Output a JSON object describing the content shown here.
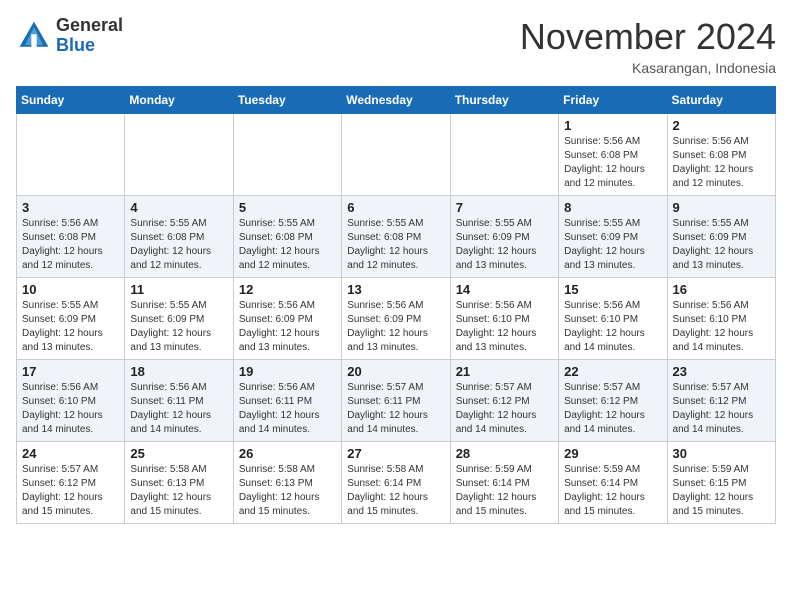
{
  "header": {
    "logo_line1": "General",
    "logo_line2": "Blue",
    "month": "November 2024",
    "location": "Kasarangan, Indonesia"
  },
  "weekdays": [
    "Sunday",
    "Monday",
    "Tuesday",
    "Wednesday",
    "Thursday",
    "Friday",
    "Saturday"
  ],
  "weeks": [
    [
      {
        "day": "",
        "info": ""
      },
      {
        "day": "",
        "info": ""
      },
      {
        "day": "",
        "info": ""
      },
      {
        "day": "",
        "info": ""
      },
      {
        "day": "",
        "info": ""
      },
      {
        "day": "1",
        "info": "Sunrise: 5:56 AM\nSunset: 6:08 PM\nDaylight: 12 hours\nand 12 minutes."
      },
      {
        "day": "2",
        "info": "Sunrise: 5:56 AM\nSunset: 6:08 PM\nDaylight: 12 hours\nand 12 minutes."
      }
    ],
    [
      {
        "day": "3",
        "info": "Sunrise: 5:56 AM\nSunset: 6:08 PM\nDaylight: 12 hours\nand 12 minutes."
      },
      {
        "day": "4",
        "info": "Sunrise: 5:55 AM\nSunset: 6:08 PM\nDaylight: 12 hours\nand 12 minutes."
      },
      {
        "day": "5",
        "info": "Sunrise: 5:55 AM\nSunset: 6:08 PM\nDaylight: 12 hours\nand 12 minutes."
      },
      {
        "day": "6",
        "info": "Sunrise: 5:55 AM\nSunset: 6:08 PM\nDaylight: 12 hours\nand 12 minutes."
      },
      {
        "day": "7",
        "info": "Sunrise: 5:55 AM\nSunset: 6:09 PM\nDaylight: 12 hours\nand 13 minutes."
      },
      {
        "day": "8",
        "info": "Sunrise: 5:55 AM\nSunset: 6:09 PM\nDaylight: 12 hours\nand 13 minutes."
      },
      {
        "day": "9",
        "info": "Sunrise: 5:55 AM\nSunset: 6:09 PM\nDaylight: 12 hours\nand 13 minutes."
      }
    ],
    [
      {
        "day": "10",
        "info": "Sunrise: 5:55 AM\nSunset: 6:09 PM\nDaylight: 12 hours\nand 13 minutes."
      },
      {
        "day": "11",
        "info": "Sunrise: 5:55 AM\nSunset: 6:09 PM\nDaylight: 12 hours\nand 13 minutes."
      },
      {
        "day": "12",
        "info": "Sunrise: 5:56 AM\nSunset: 6:09 PM\nDaylight: 12 hours\nand 13 minutes."
      },
      {
        "day": "13",
        "info": "Sunrise: 5:56 AM\nSunset: 6:09 PM\nDaylight: 12 hours\nand 13 minutes."
      },
      {
        "day": "14",
        "info": "Sunrise: 5:56 AM\nSunset: 6:10 PM\nDaylight: 12 hours\nand 13 minutes."
      },
      {
        "day": "15",
        "info": "Sunrise: 5:56 AM\nSunset: 6:10 PM\nDaylight: 12 hours\nand 14 minutes."
      },
      {
        "day": "16",
        "info": "Sunrise: 5:56 AM\nSunset: 6:10 PM\nDaylight: 12 hours\nand 14 minutes."
      }
    ],
    [
      {
        "day": "17",
        "info": "Sunrise: 5:56 AM\nSunset: 6:10 PM\nDaylight: 12 hours\nand 14 minutes."
      },
      {
        "day": "18",
        "info": "Sunrise: 5:56 AM\nSunset: 6:11 PM\nDaylight: 12 hours\nand 14 minutes."
      },
      {
        "day": "19",
        "info": "Sunrise: 5:56 AM\nSunset: 6:11 PM\nDaylight: 12 hours\nand 14 minutes."
      },
      {
        "day": "20",
        "info": "Sunrise: 5:57 AM\nSunset: 6:11 PM\nDaylight: 12 hours\nand 14 minutes."
      },
      {
        "day": "21",
        "info": "Sunrise: 5:57 AM\nSunset: 6:12 PM\nDaylight: 12 hours\nand 14 minutes."
      },
      {
        "day": "22",
        "info": "Sunrise: 5:57 AM\nSunset: 6:12 PM\nDaylight: 12 hours\nand 14 minutes."
      },
      {
        "day": "23",
        "info": "Sunrise: 5:57 AM\nSunset: 6:12 PM\nDaylight: 12 hours\nand 14 minutes."
      }
    ],
    [
      {
        "day": "24",
        "info": "Sunrise: 5:57 AM\nSunset: 6:12 PM\nDaylight: 12 hours\nand 15 minutes."
      },
      {
        "day": "25",
        "info": "Sunrise: 5:58 AM\nSunset: 6:13 PM\nDaylight: 12 hours\nand 15 minutes."
      },
      {
        "day": "26",
        "info": "Sunrise: 5:58 AM\nSunset: 6:13 PM\nDaylight: 12 hours\nand 15 minutes."
      },
      {
        "day": "27",
        "info": "Sunrise: 5:58 AM\nSunset: 6:14 PM\nDaylight: 12 hours\nand 15 minutes."
      },
      {
        "day": "28",
        "info": "Sunrise: 5:59 AM\nSunset: 6:14 PM\nDaylight: 12 hours\nand 15 minutes."
      },
      {
        "day": "29",
        "info": "Sunrise: 5:59 AM\nSunset: 6:14 PM\nDaylight: 12 hours\nand 15 minutes."
      },
      {
        "day": "30",
        "info": "Sunrise: 5:59 AM\nSunset: 6:15 PM\nDaylight: 12 hours\nand 15 minutes."
      }
    ]
  ]
}
